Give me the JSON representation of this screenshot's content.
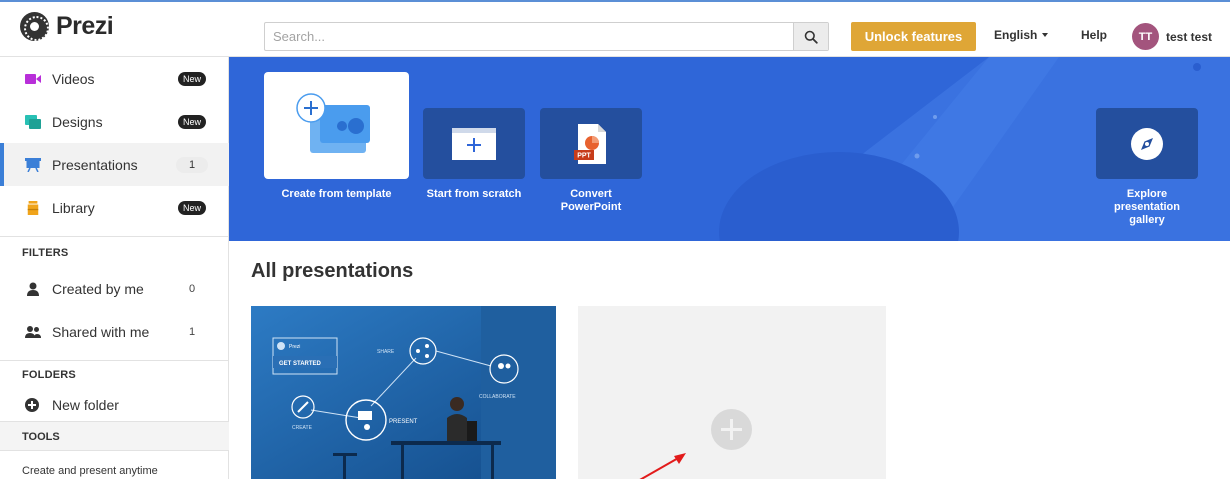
{
  "app": {
    "logo_text": "Prezi"
  },
  "search": {
    "placeholder": "Search..."
  },
  "header": {
    "unlock_label": "Unlock features",
    "language_label": "English",
    "help_label": "Help",
    "avatar_initials": "TT",
    "user_name": "test test"
  },
  "sidebar": {
    "items": [
      {
        "label": "Videos",
        "badge": "New",
        "icon": "video-icon",
        "color": "#b82fd9"
      },
      {
        "label": "Designs",
        "badge": "New",
        "icon": "designs-icon",
        "color": "#28c0b4"
      },
      {
        "label": "Presentations",
        "count": "1",
        "icon": "presentation-icon",
        "color": "#3b7fd7",
        "active": true
      },
      {
        "label": "Library",
        "badge": "New",
        "icon": "library-icon",
        "color": "#f0a41b"
      }
    ],
    "filters_heading": "FILTERS",
    "filters": [
      {
        "label": "Created by me",
        "count": "0",
        "icon": "user-icon"
      },
      {
        "label": "Shared with me",
        "count": "1",
        "icon": "users-icon"
      }
    ],
    "folders_heading": "FOLDERS",
    "new_folder_label": "New folder",
    "tools_heading": "TOOLS",
    "tools_text": "Create and present anytime"
  },
  "hero": {
    "background_color": "#2f66d8",
    "tiles": [
      {
        "label": "Create from template",
        "icon": "template-icon"
      },
      {
        "label": "Start from scratch",
        "icon": "scratch-plus-icon"
      },
      {
        "label": "Convert PowerPoint",
        "label_line1": "Convert",
        "label_line2": "PowerPoint",
        "icon": "ppt-icon",
        "icon_text": "PPT"
      },
      {
        "label": "Explore presentation gallery",
        "label_line1": "Explore",
        "label_line2": "presentation",
        "label_line3": "gallery",
        "icon": "compass-icon"
      }
    ]
  },
  "content": {
    "title": "All presentations",
    "thumbnail": {
      "logo_text": "Prezi",
      "get_started": "GET STARTED",
      "share": "SHARE",
      "collaborate": "COLLABORATE",
      "present": "PRESENT",
      "create": "CREATE"
    }
  },
  "colors": {
    "accent": "#3b7fd7",
    "unlock": "#dfa636",
    "avatar": "#a3547d"
  }
}
